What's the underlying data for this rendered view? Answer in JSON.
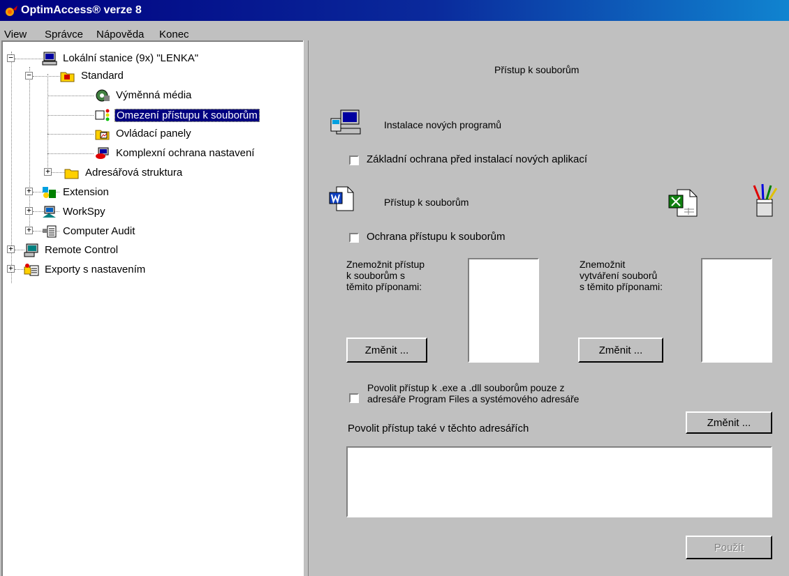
{
  "window": {
    "title": "OptimAccess® verze 8"
  },
  "menu": [
    {
      "label": "View"
    },
    {
      "label": "Správce"
    },
    {
      "label": "Nápověda"
    },
    {
      "label": "Konec"
    }
  ],
  "tree": {
    "root": "Lokální stanice (9x) \"LENKA\"",
    "standard": "Standard",
    "standard_children": [
      "Výměnná média",
      "Omezení přístupu k souborům",
      "Ovládací panely",
      "Komplexní ochrana nastavení",
      "Adresářová struktura"
    ],
    "extension": "Extension",
    "workspy": "WorkSpy",
    "computer_audit": "Computer Audit",
    "remote_control": "Remote Control",
    "exports": "Exporty s nastavením",
    "selected": "Omezení přístupu k souborům"
  },
  "panel": {
    "header": "Přístup k souborům",
    "install_section_label": "Instalace nových programů",
    "install_checkbox_label": "Základní ochrana před instalací nových aplikací",
    "access_section_label": "Přístup k souborům",
    "access_checkbox_label": "Ochrana přístupu k souborům",
    "deny_access_label_1": "Znemožnit přístup",
    "deny_access_label_2": "k souborům s",
    "deny_access_label_3": "těmito příponami:",
    "deny_create_label_1": "Znemožnit",
    "deny_create_label_2": "vytváření souborů",
    "deny_create_label_3": "s těmito příponami:",
    "change_button": "Změnit ...",
    "exe_checkbox_line1": "Povolit přístup k .exe a .dll souborům pouze z",
    "exe_checkbox_line2": "adresáře Program Files a systémového adresáře",
    "allow_dirs_label": "Povolit přístup také v těchto adresářích",
    "apply_button": "Použít",
    "checkboxes_checked": {
      "install": false,
      "access": false,
      "exe": false
    }
  }
}
